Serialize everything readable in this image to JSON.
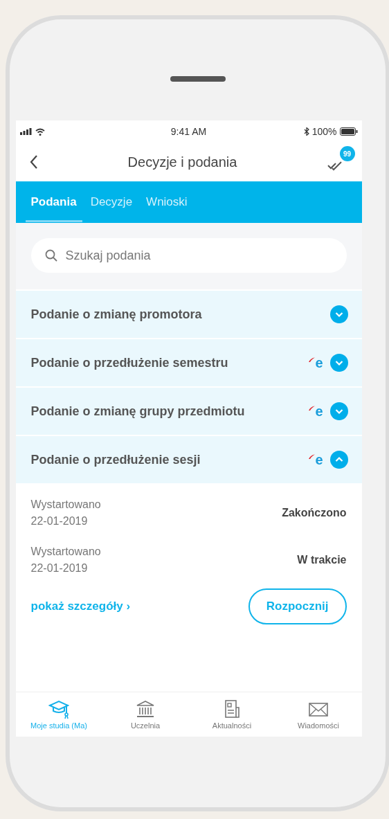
{
  "status_bar": {
    "time": "9:41 AM",
    "battery": "100%"
  },
  "header": {
    "title": "Decyzje i podania",
    "badge": "99"
  },
  "tabs": [
    {
      "label": "Podania",
      "selected": true
    },
    {
      "label": "Decyzje",
      "selected": false
    },
    {
      "label": "Wnioski",
      "selected": false
    }
  ],
  "search": {
    "placeholder": "Szukaj podania"
  },
  "items": [
    {
      "title": "Podanie o zmianę promotora",
      "expanded": false
    },
    {
      "title": "Podanie o przedłużenie semestru",
      "logo": "e",
      "expanded": false
    },
    {
      "title": "Podanie o zmianę grupy przedmiotu",
      "logo": "e",
      "expanded": false
    },
    {
      "title": "Podanie o przedłużenie sesji",
      "logo": "e",
      "expanded": true,
      "entries": [
        {
          "label": "Wystartowano",
          "date": "22-01-2019",
          "status": "Zakończono"
        },
        {
          "label": "Wystartowano",
          "date": "22-01-2019",
          "status": "W trakcie"
        }
      ],
      "details_link": "pokaż szczegóły",
      "details_arrow": "›",
      "action": "Rozpocznij"
    }
  ],
  "bottom_nav": [
    {
      "label": "Moje studia (Ma)",
      "kind": "cap",
      "selected": true
    },
    {
      "label": "Uczelnia",
      "kind": "building",
      "selected": false
    },
    {
      "label": "Aktualności",
      "kind": "news",
      "selected": false
    },
    {
      "label": "Wiadomości",
      "kind": "mail",
      "selected": false
    }
  ]
}
